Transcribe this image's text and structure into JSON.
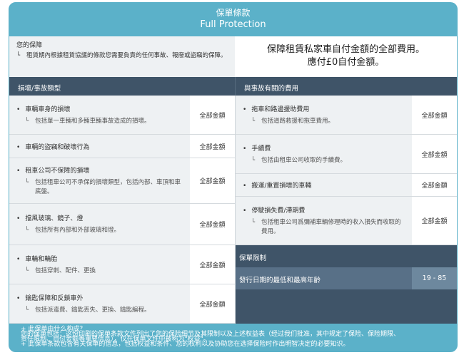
{
  "header": {
    "title": "保單條款",
    "subtitle": "Full Protection"
  },
  "coverage": {
    "label": "您的保障",
    "description": "租賃期內根據租賃協議的條款您需要負責的任何事故、報廢或盜竊的保障。",
    "summary_line1": "保障租賃私家車自付金額的全部費用。",
    "summary_line2": "應付£0自付金額。"
  },
  "sections": {
    "left_title": "損壞/事故類型",
    "right_title": "與事故有關的費用"
  },
  "left_items": [
    {
      "title": "車輛車身的損壞",
      "detail": "包括單一車輛和多輛車輛事故造成的損壞。",
      "amount": "全部金額"
    },
    {
      "title": "車輛的盜竊和破壞行為",
      "detail": "",
      "amount": "全部金額"
    },
    {
      "title": "租車公司不保障的損壞",
      "detail": "包括租車公司不承保的損壞類型，包括內部、車頂和車底盤。",
      "amount": "全部金額"
    },
    {
      "title": "擋風玻璃、鏡子、燈",
      "detail": "包括所有內部和外部玻璃和燈。",
      "amount": "全部金額"
    },
    {
      "title": "車輪和輪胎",
      "detail": "包括穿刺、配件、更換",
      "amount": "全部金額"
    },
    {
      "title": "鑰匙保障和反鎖車外",
      "detail": "包括派遣費、鑰匙丟失、更換、鑰匙編程。",
      "amount": "全部金額"
    }
  ],
  "right_items": [
    {
      "title": "拖車和路邊援助費用",
      "detail": "包括道路救援和拖車費用。",
      "amount": "全部金額"
    },
    {
      "title": "手續費",
      "detail": "包括由租車公司收取的手續費。",
      "amount": "全部金額"
    },
    {
      "title": "搬運/重置損壞的車輛",
      "detail": "",
      "amount": "全部金額"
    },
    {
      "title": "停駛損失費/滯期費",
      "detail": "包括租車公司爲彌補車輛修理時的收入損失而收取的費用。",
      "amount": "全部金額"
    }
  ],
  "limits": {
    "title": "保單限制",
    "age_label": "發行日期的最低和最高年齡",
    "age_value": "19 - 85"
  },
  "footer": {
    "line1": "+ 此保单由什么构成？",
    "line2": "您的保单包括：这份印刷的保单条款文件列出了您的保险细节及其限制以及上述权益表（经过我们批准，其中规定了保险、保险期限、",
    "line3": "责任限制、自付金额等重要信息），仅在保单文件中被称为\"权益\"。",
    "line4": "+ 此保单条款包含有关保单的信息，包括权益和条件、您的权利以及协助您在选择保险时作出明智决定的必要知识。"
  }
}
